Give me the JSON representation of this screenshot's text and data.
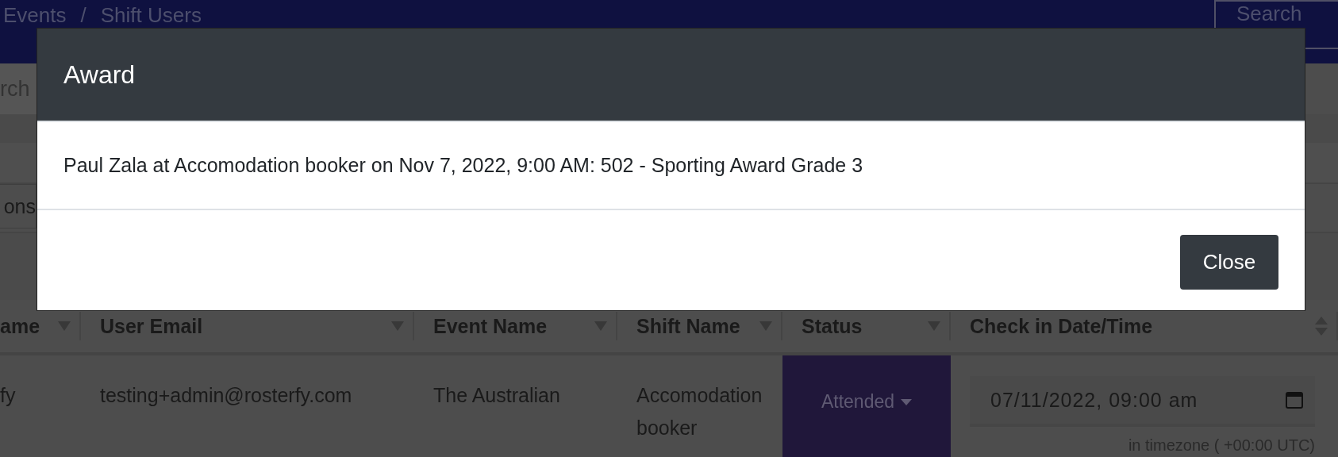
{
  "navbar": {
    "breadcrumb": [
      "Events",
      "Shift Users"
    ],
    "separator": "/",
    "search_button": "Search"
  },
  "toolbar": {
    "search_placeholder": "rch",
    "options_button": "ons"
  },
  "table": {
    "columns": [
      {
        "label": "ame"
      },
      {
        "label": "User Email"
      },
      {
        "label": "Event Name"
      },
      {
        "label": "Shift Name"
      },
      {
        "label": "Status"
      },
      {
        "label": "Check in Date/Time"
      }
    ],
    "rows": [
      {
        "cells": [
          "fy",
          "testing+admin@rosterfy.com",
          "The Australian",
          "Accomodation booker"
        ],
        "status": "Attended",
        "check_in": "07/11/2022, 09:00 am",
        "timezone": "in timezone ( +00:00 UTC)"
      }
    ]
  },
  "modal": {
    "title": "Award",
    "message": "Paul Zala at Accomodation booker on Nov 7, 2022, 9:00 AM: 502 - Sporting Award Grade 3",
    "close_button": "Close"
  }
}
